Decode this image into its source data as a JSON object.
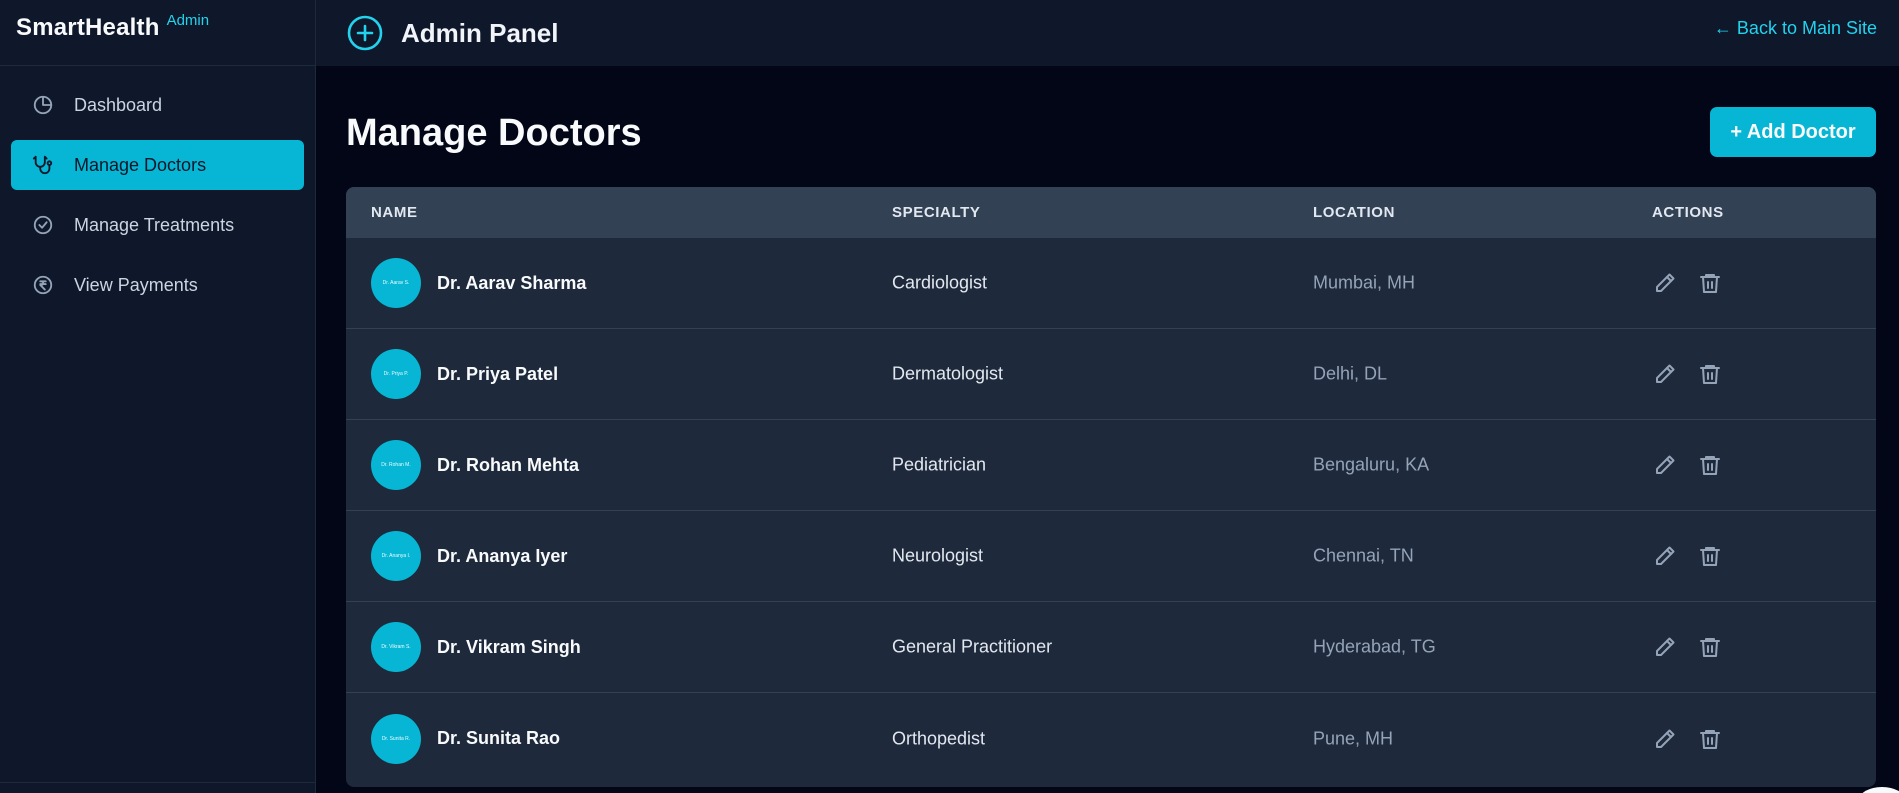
{
  "brand": {
    "name": "SmartHealth",
    "tag": "Admin"
  },
  "sidebar": {
    "items": [
      {
        "label": "Dashboard",
        "icon": "pie-chart-icon",
        "active": false
      },
      {
        "label": "Manage Doctors",
        "icon": "stethoscope-icon",
        "active": true
      },
      {
        "label": "Manage Treatments",
        "icon": "check-circle-icon",
        "active": false
      },
      {
        "label": "View Payments",
        "icon": "rupee-circle-icon",
        "active": false
      }
    ]
  },
  "header": {
    "title": "Admin Panel",
    "icon": "plus-circle-icon",
    "back_link": "← Back to Main Site"
  },
  "main": {
    "title": "Manage Doctors",
    "add_button": "+ Add Doctor"
  },
  "table": {
    "columns": [
      "NAME",
      "SPECIALTY",
      "LOCATION",
      "ACTIONS"
    ],
    "rows": [
      {
        "avatar": "Dr. Aarav S.",
        "name": "Dr. Aarav Sharma",
        "specialty": "Cardiologist",
        "location": "Mumbai, MH"
      },
      {
        "avatar": "Dr. Priya P.",
        "name": "Dr. Priya Patel",
        "specialty": "Dermatologist",
        "location": "Delhi, DL"
      },
      {
        "avatar": "Dr. Rohan M.",
        "name": "Dr. Rohan Mehta",
        "specialty": "Pediatrician",
        "location": "Bengaluru, KA"
      },
      {
        "avatar": "Dr. Ananya I.",
        "name": "Dr. Ananya Iyer",
        "specialty": "Neurologist",
        "location": "Chennai, TN"
      },
      {
        "avatar": "Dr. Vikram S.",
        "name": "Dr. Vikram Singh",
        "specialty": "General Practitioner",
        "location": "Hyderabad, TG"
      },
      {
        "avatar": "Dr. Sunita R.",
        "name": "Dr. Sunita Rao",
        "specialty": "Orthopedist",
        "location": "Pune, MH"
      }
    ]
  },
  "colors": {
    "accent": "#06b6d4",
    "accent_text": "#22d3ee",
    "sidebar_bg": "#0f172a",
    "page_bg": "#020617",
    "table_bg": "#1e293b",
    "table_header_bg": "#334155"
  }
}
